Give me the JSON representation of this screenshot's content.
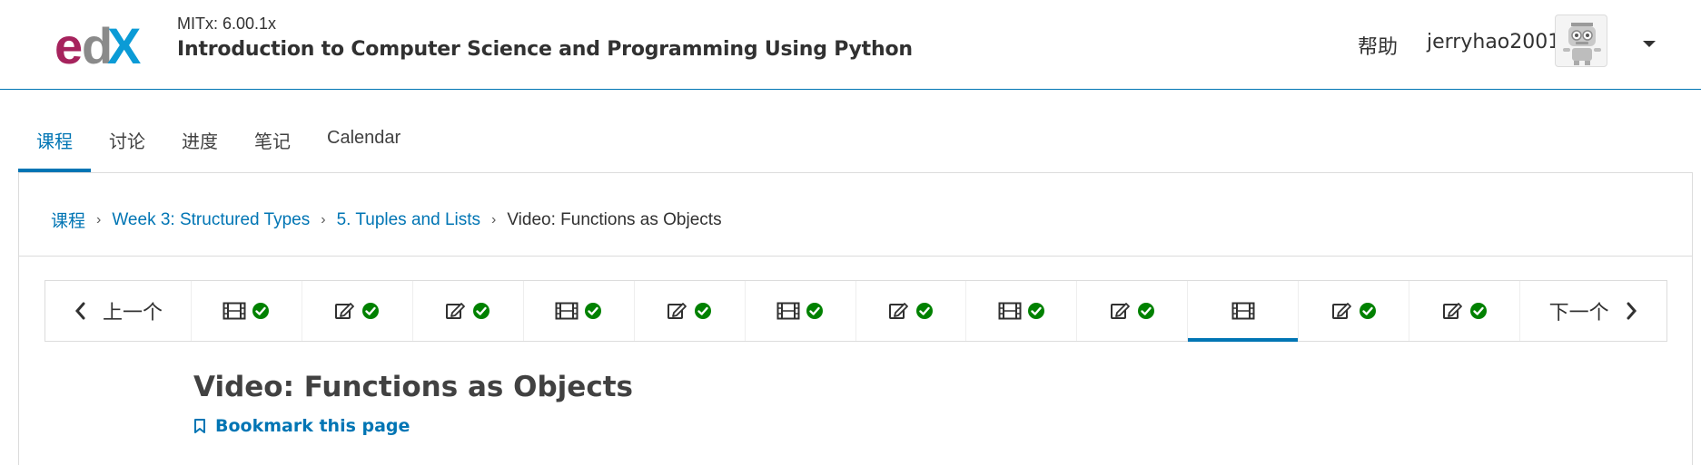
{
  "header": {
    "course_org": "MITx: 6.00.1x",
    "course_title": "Introduction to Computer Science and Programming Using Python",
    "help_label": "帮助",
    "username": "jerryhao2001",
    "logo_text": "edX"
  },
  "tabs": [
    {
      "label": "课程",
      "active": true
    },
    {
      "label": "讨论",
      "active": false
    },
    {
      "label": "进度",
      "active": false
    },
    {
      "label": "笔记",
      "active": false
    },
    {
      "label": "Calendar",
      "active": false
    }
  ],
  "breadcrumb": {
    "items": [
      "课程",
      "Week 3: Structured Types",
      "5. Tuples and Lists"
    ],
    "current": "Video: Functions as Objects"
  },
  "sequence": {
    "prev_label": "上一个",
    "next_label": "下一个",
    "items": [
      {
        "type": "video",
        "complete": true,
        "active": false
      },
      {
        "type": "problem",
        "complete": true,
        "active": false
      },
      {
        "type": "problem",
        "complete": true,
        "active": false
      },
      {
        "type": "video",
        "complete": true,
        "active": false
      },
      {
        "type": "problem",
        "complete": true,
        "active": false
      },
      {
        "type": "video",
        "complete": true,
        "active": false
      },
      {
        "type": "problem",
        "complete": true,
        "active": false
      },
      {
        "type": "video",
        "complete": true,
        "active": false
      },
      {
        "type": "problem",
        "complete": true,
        "active": false
      },
      {
        "type": "video",
        "complete": false,
        "active": true
      },
      {
        "type": "problem",
        "complete": true,
        "active": false
      },
      {
        "type": "problem",
        "complete": true,
        "active": false
      }
    ]
  },
  "unit": {
    "title": "Video: Functions as Objects",
    "bookmark_label": "Bookmark this page"
  },
  "colors": {
    "accent": "#0075b4",
    "complete": "#008100",
    "logo_e": "#a6235d",
    "logo_d": "#767676",
    "logo_x": "#0b9bd6"
  }
}
